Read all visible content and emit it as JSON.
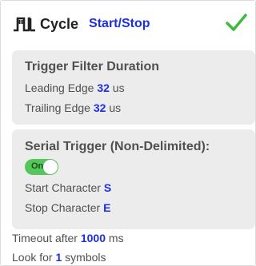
{
  "header": {
    "title": "Cycle",
    "mode": "Start/Stop",
    "status_color": "#3dbb3d"
  },
  "trigger_filter": {
    "title": "Trigger Filter Duration",
    "leading_label": "Leading Edge",
    "leading_value": "32",
    "leading_unit": "us",
    "trailing_label": "Trailing Edge",
    "trailing_value": "32",
    "trailing_unit": "us"
  },
  "serial_trigger": {
    "title": "Serial Trigger (Non-Delimited):",
    "toggle_label": "On",
    "start_label": "Start Character",
    "start_value": "S",
    "stop_label": "Stop Character",
    "stop_value": "E"
  },
  "timeout": {
    "prefix": "Timeout after",
    "value": "1000",
    "unit": "ms"
  },
  "symbols": {
    "prefix": "Look for",
    "value": "1",
    "unit": "symbols"
  },
  "colors": {
    "accent": "#1d2ee0",
    "toggle_on": "#55c75a",
    "box_bg": "#ececec"
  }
}
